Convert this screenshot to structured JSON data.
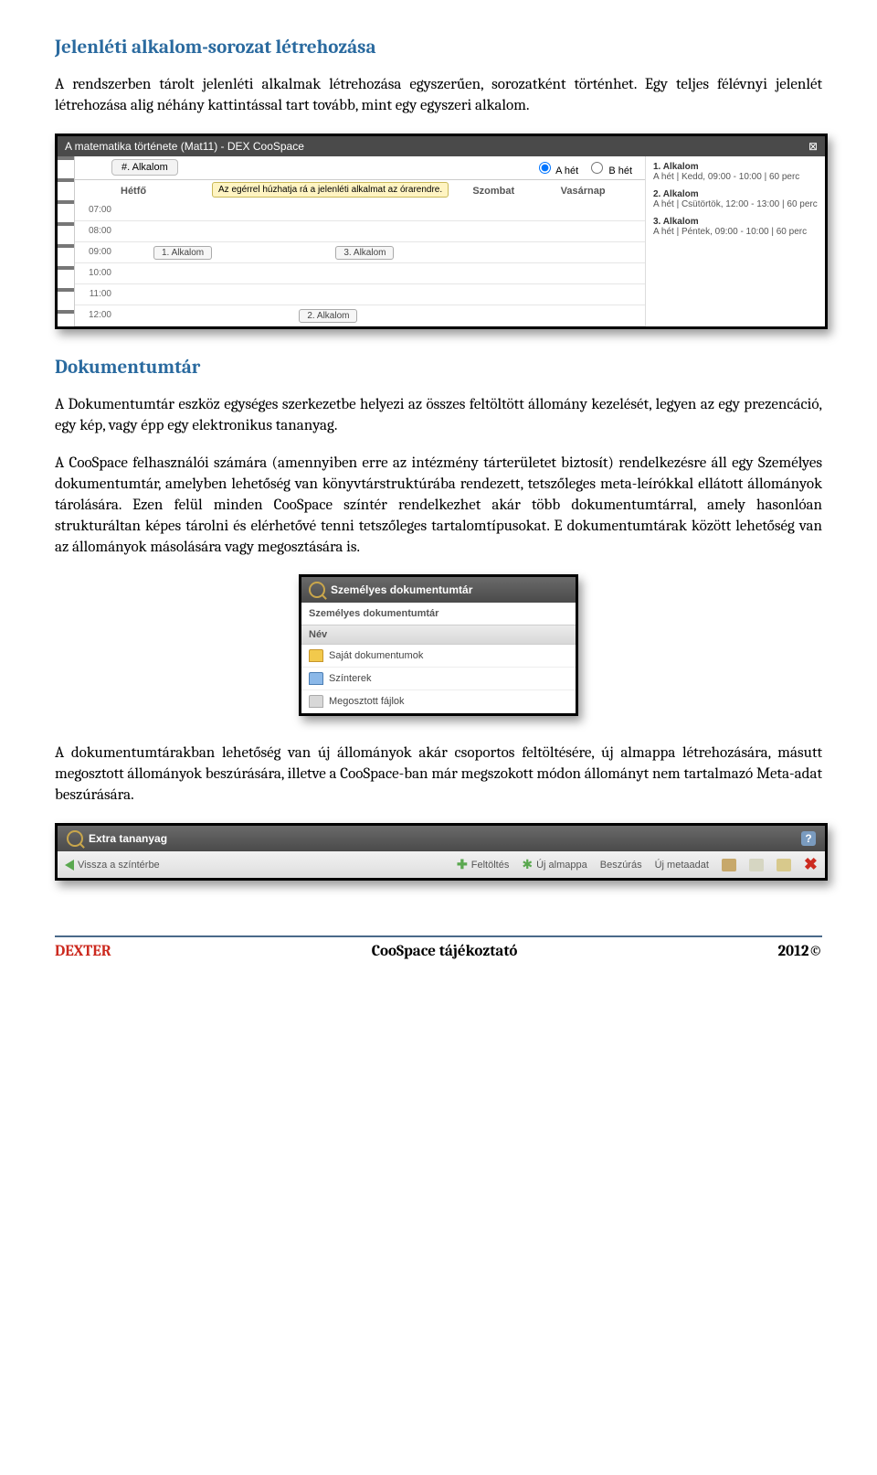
{
  "section1_title": "Jelenléti alkalom-sorozat létrehozása",
  "para1": "A rendszerben tárolt jelenléti alkalmak létrehozása egyszerűen, sorozatként történhet. Egy teljes félévnyi jelenlét létrehozása alig néhány kattintással tart tovább, mint egy egyszeri alkalom.",
  "sched": {
    "window_title": "A matematika története (Mat11) - DEX CooSpace",
    "pill": "#. Alkalom",
    "radio_a": "A hét",
    "radio_b": "B hét",
    "tooltip": "Az egérrel húzhatja rá a jelenléti alkalmat az órarendre.",
    "day_hetfo": "Hétfő",
    "day_szombat": "Szombat",
    "day_vasarnap": "Vasárnap",
    "times": [
      "07:00",
      "08:00",
      "09:00",
      "10:00",
      "11:00",
      "12:00"
    ],
    "ev1": "1. Alkalom",
    "ev2": "2. Alkalom",
    "ev3": "3. Alkalom",
    "side": [
      {
        "t": "1. Alkalom",
        "d": "A hét | Kedd, 09:00 - 10:00 | 60 perc"
      },
      {
        "t": "2. Alkalom",
        "d": "A hét | Csütörtök, 12:00 - 13:00 | 60 perc"
      },
      {
        "t": "3. Alkalom",
        "d": "A hét | Péntek, 09:00 - 10:00 | 60 perc"
      }
    ]
  },
  "section2_title": "Dokumentumtár",
  "para2": "A Dokumentumtár eszköz egységes szerkezetbe helyezi az összes feltöltött állomány kezelését, legyen az egy prezencáció, egy kép, vagy épp egy elektronikus tananyag.",
  "para3": "A CooSpace felhasználói számára (amennyiben erre az intézmény tárterületet biztosít) rendelkezésre áll egy Személyes dokumentumtár, amelyben lehetőség van könyvtárstruktúrába rendezett, tetszőleges meta-leírókkal ellátott állományok tárolására. Ezen felül minden CooSpace színtér rendelkezhet akár több dokumentumtárral, amely hasonlóan strukturáltan képes tárolni és elérhetővé tenni tetszőleges tartalomtípusokat. E dokumentumtárak között lehetőség van az állományok másolására vagy megosztására is.",
  "dok": {
    "title": "Személyes dokumentumtár",
    "subtitle": "Személyes dokumentumtár",
    "col_name": "Név",
    "rows": [
      "Saját dokumentumok",
      "Színterek",
      "Megosztott fájlok"
    ]
  },
  "para4": "A dokumentumtárakban lehetőség van új állományok akár csoportos feltöltésére, új almappa létrehozására, másutt megosztott állományok beszúrására, illetve a CooSpace-ban már megszokott módon állományt nem tartalmazó Meta-adat beszúrására.",
  "tb": {
    "title": "Extra tananyag",
    "back": "Vissza a színtérbe",
    "upload": "Feltöltés",
    "newfolder": "Új almappa",
    "insert": "Beszúrás",
    "meta": "Új metaadat"
  },
  "footer": {
    "left": "DEXTER",
    "mid": "CooSpace tájékoztató",
    "right": "2012©"
  }
}
